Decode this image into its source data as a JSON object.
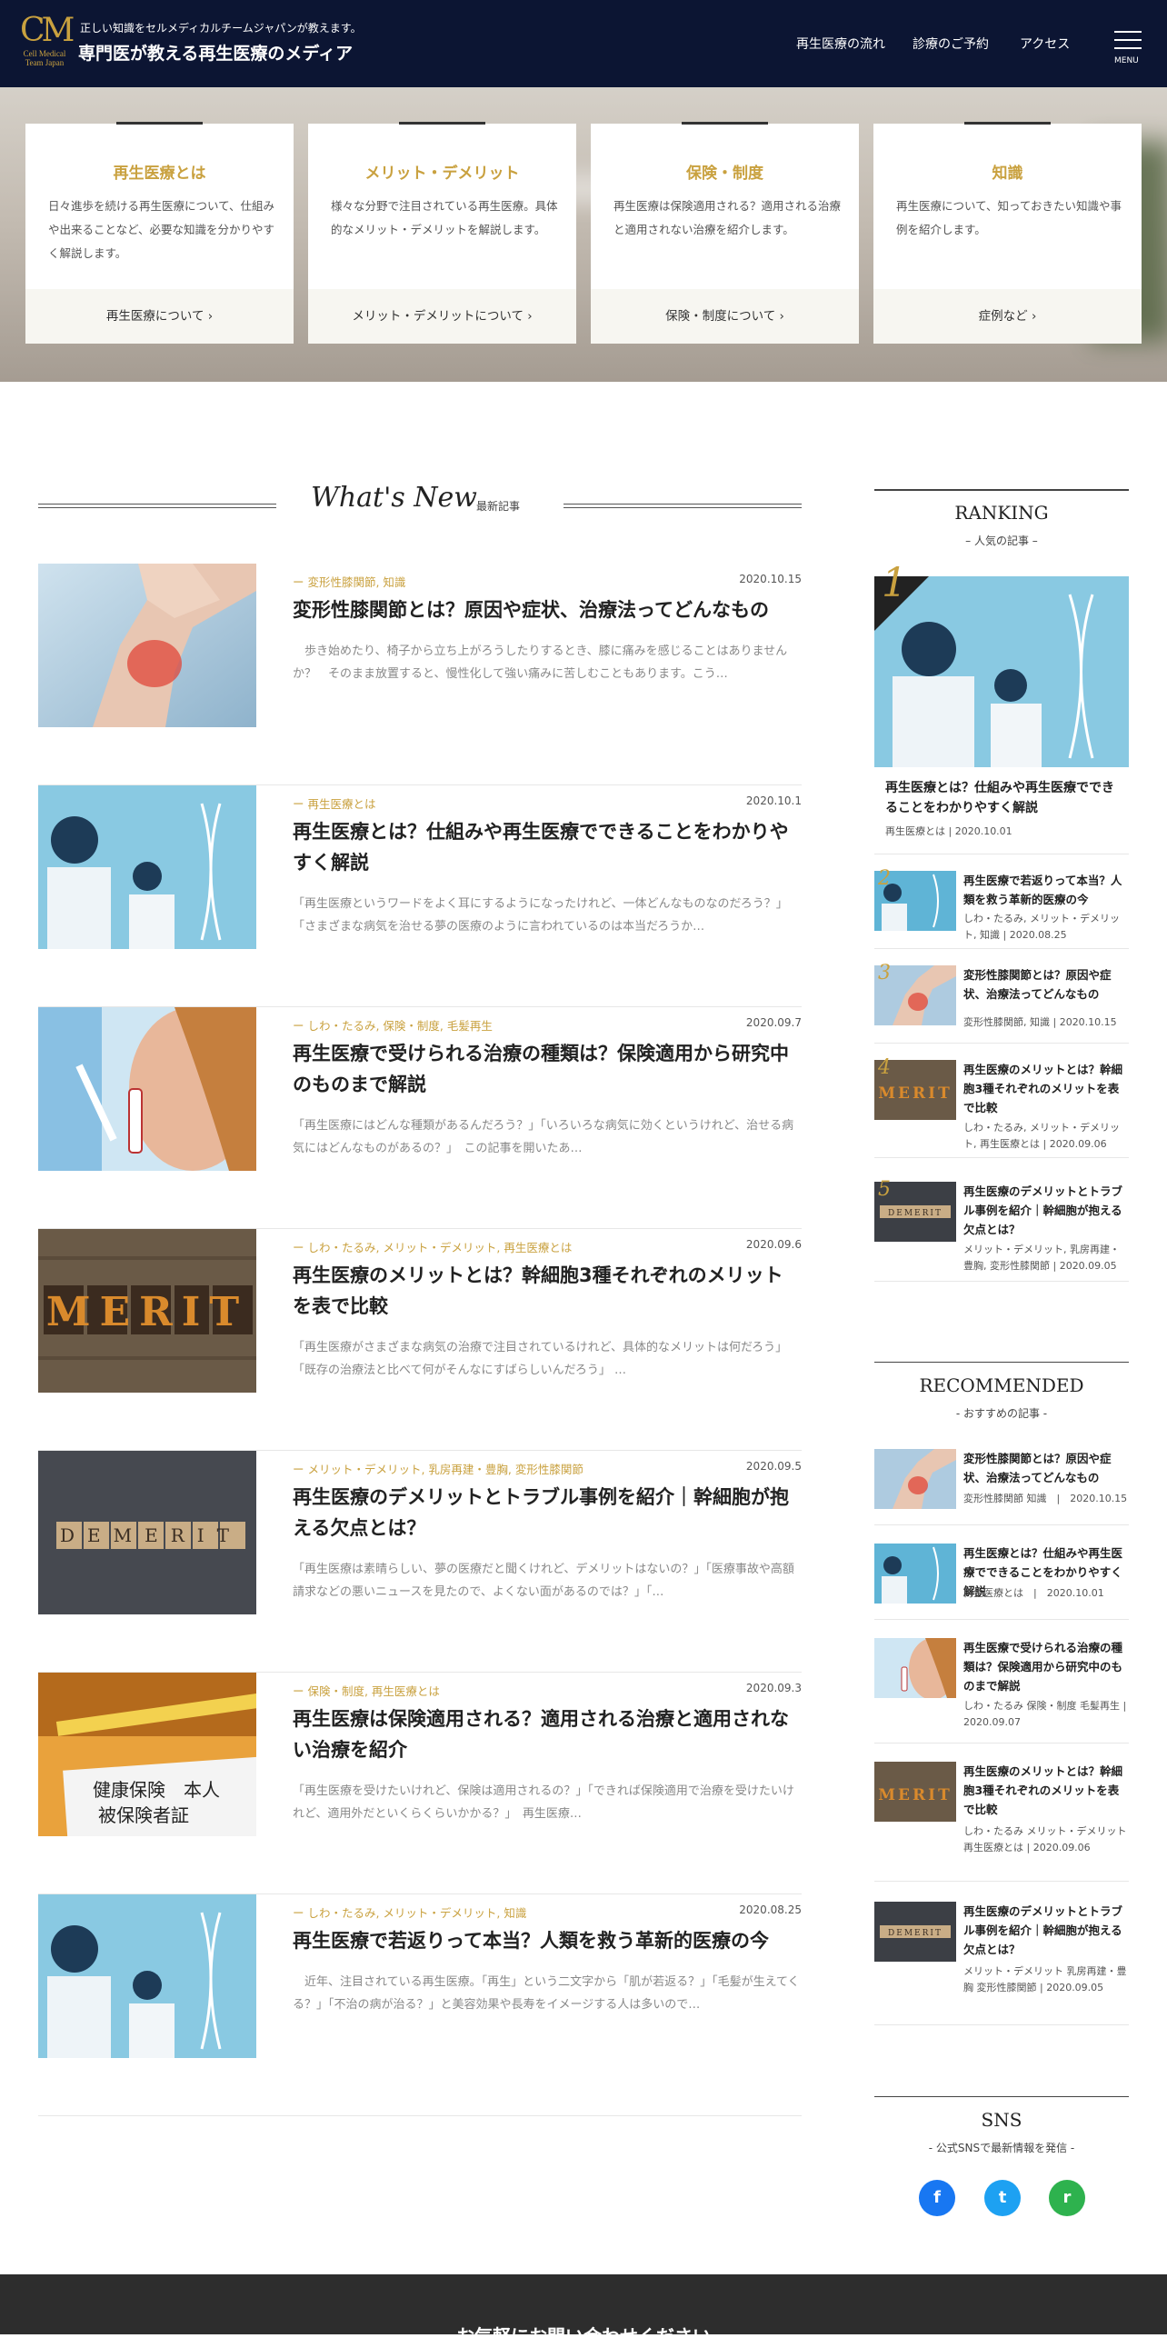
{
  "header": {
    "logo_mark": "CM",
    "logo_sub1": "Cell Medical",
    "logo_sub2": "Team Japan",
    "tagline": "正しい知識をセルメディカルチームジャパンが教えます。",
    "site_title": "専門医が教える再生医療のメディア",
    "nav": [
      "再生医療の流れ",
      "診療のご予約",
      "アクセス"
    ],
    "menu_label": "MENU"
  },
  "categories": [
    {
      "title": "再生医療とは",
      "desc": "日々進歩を続ける再生医療について、仕組みや出来ることなど、必要な知識を分かりやすく解説します。",
      "link": "再生医療について"
    },
    {
      "title": "メリット・デメリット",
      "desc": "様々な分野で注目されている再生医療。具体的なメリット・デメリットを解説します。",
      "link": "メリット・デメリットについて"
    },
    {
      "title": "保険・制度",
      "desc": "再生医療は保険適用される？適用される治療と適用されない治療を紹介します。",
      "link": "保険・制度について"
    },
    {
      "title": "知識",
      "desc": "再生医療について、知っておきたい知識や事例を紹介します。",
      "link": "症例など"
    }
  ],
  "whats_new": {
    "en": "What's New",
    "ja": "最新記事"
  },
  "articles": [
    {
      "cat": "ー 変形性膝関節, 知識",
      "date": "2020.10.15",
      "title": "変形性膝関節とは？原因や症状、治療法ってどんなもの",
      "excerpt": "　歩き始めたり、椅子から立ち上がろうしたりするとき、膝に痛みを感じることはありませんか？　そのまま放置すると、慢性化して強い痛みに苦しむこともあります。こう…"
    },
    {
      "cat": "ー 再生医療とは",
      "date": "2020.10.1",
      "title": "再生医療とは？仕組みや再生医療でできることをわかりやすく解説",
      "excerpt": "「再生医療というワードをよく耳にするようになったけれど、一体どんなものなのだろう？」「さまざまな病気を治せる夢の医療のように言われているのは本当だろうか…"
    },
    {
      "cat": "ー しわ・たるみ, 保険・制度, 毛髪再生",
      "date": "2020.09.7",
      "title": "再生医療で受けられる治療の種類は？保険適用から研究中のものまで解説",
      "excerpt": "「再生医療にはどんな種類があるんだろう？」「いろいろな病気に効くというけれど、治せる病気にはどんなものがあるの？」　この記事を開いたあ…"
    },
    {
      "cat": "ー しわ・たるみ, メリット・デメリット, 再生医療とは",
      "date": "2020.09.6",
      "title": "再生医療のメリットとは？幹細胞3種それぞれのメリットを表で比較",
      "excerpt": "「再生医療がさまざまな病気の治療で注目されているけれど、具体的なメリットは何だろう」「既存の治療法と比べて何がそんなにすばらしいんだろう」 …"
    },
    {
      "cat": "ー メリット・デメリット, 乳房再建・豊胸, 変形性膝関節",
      "date": "2020.09.5",
      "title": "再生医療のデメリットとトラブル事例を紹介｜幹細胞が抱える欠点とは？",
      "excerpt": "「再生医療は素晴らしい、夢の医療だと聞くけれど、デメリットはないの？」「医療事故や高額請求などの悪いニュースを見たので、よくない面があるのでは？」「…"
    },
    {
      "cat": "ー 保険・制度, 再生医療とは",
      "date": "2020.09.3",
      "title": "再生医療は保険適用される？適用される治療と適用されない治療を紹介",
      "excerpt": "「再生医療を受けたいけれど、保険は適用されるの？」「できれば保険適用で治療を受けたいけれど、適用外だといくらくらいかかる？」　再生医療…"
    },
    {
      "cat": "ー しわ・たるみ, メリット・デメリット, 知識",
      "date": "2020.08.25",
      "title": "再生医療で若返りって本当？人類を救う革新的医療の今",
      "excerpt": "　近年、注目されている再生医療。「再生」という二文字から「肌が若返る？」「毛髪が生えてくる？」「不治の病が治る？」と美容効果や長寿をイメージする人は多いので…"
    }
  ],
  "ranking": {
    "title": "RANKING",
    "sub": "– 人気の記事 –",
    "top": {
      "num": "1",
      "title": "再生医療とは？仕組みや再生医療でできることをわかりやすく解説",
      "meta": "再生医療とは | 2020.10.01"
    },
    "items": [
      {
        "num": "2",
        "title": "再生医療で若返りって本当？人類を救う革新的医療の今",
        "meta": "しわ・たるみ, メリット・デメリット, 知識 | 2020.08.25"
      },
      {
        "num": "3",
        "title": "変形性膝関節とは？原因や症状、治療法ってどんなもの",
        "meta": "変形性膝関節, 知識 | 2020.10.15"
      },
      {
        "num": "4",
        "title": "再生医療のメリットとは？幹細胞3種それぞれのメリットを表で比較",
        "meta": "しわ・たるみ, メリット・デメリット, 再生医療とは | 2020.09.06"
      },
      {
        "num": "5",
        "title": "再生医療のデメリットとトラブル事例を紹介｜幹細胞が抱える欠点とは？",
        "meta": "メリット・デメリット, 乳房再建・豊胸, 変形性膝関節 | 2020.09.05"
      }
    ]
  },
  "recommended": {
    "title": "RECOMMENDED",
    "sub": "- おすすめの記事 -",
    "items": [
      {
        "title": "変形性膝関節とは？原因や症状、治療法ってどんなもの",
        "meta": "変形性膝関節 知識　|　2020.10.15"
      },
      {
        "title": "再生医療とは？仕組みや再生医療でできることをわかりやすく解説",
        "meta": "再生医療とは　|　2020.10.01"
      },
      {
        "title": "再生医療で受けられる治療の種類は？保険適用から研究中のものまで解説",
        "meta": "しわ・たるみ 保険・制度 毛髪再生 | 2020.09.07"
      },
      {
        "title": "再生医療のメリットとは？幹細胞3種それぞれのメリットを表で比較",
        "meta": "しわ・たるみ メリット・デメリット 再生医療とは | 2020.09.06"
      },
      {
        "title": "再生医療のデメリットとトラブル事例を紹介｜幹細胞が抱える欠点とは？",
        "meta": "メリット・デメリット 乳房再建・豊胸 変形性膝関節 | 2020.09.05"
      }
    ]
  },
  "sns": {
    "title": "SNS",
    "sub": "- 公式SNSで最新情報を発信 -",
    "icons": [
      "facebook-icon",
      "twitter-icon",
      "rss-icon"
    ],
    "glyphs": [
      "f",
      "t",
      "r"
    ],
    "colors": [
      "#1877f2",
      "#1da1f2",
      "#2eb24e"
    ]
  },
  "footer": {
    "cta": "お気軽にお問い合わせください"
  },
  "colors": {
    "navy": "#0c1533",
    "gold": "#c9a13f"
  }
}
